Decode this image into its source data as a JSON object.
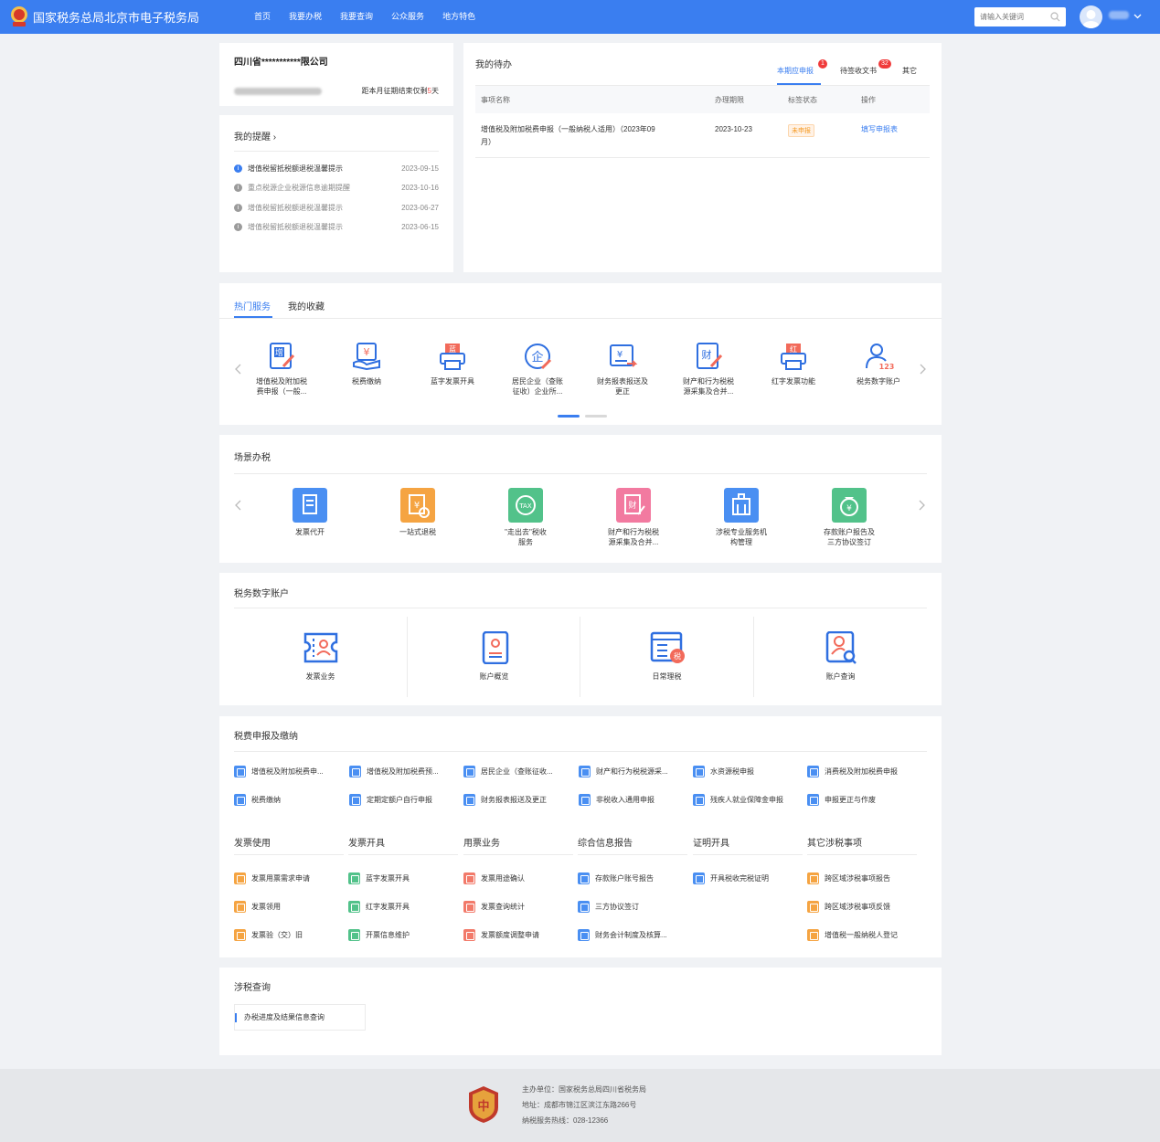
{
  "header": {
    "title": "国家税务总局北京市电子税务局",
    "nav": [
      "首页",
      "我要办税",
      "我要查询",
      "公众服务",
      "地方特色"
    ],
    "search_placeholder": "请输入关键词"
  },
  "company": {
    "name": "四川省***********限公司",
    "deadline_prefix": "距本月征期结束仅剩",
    "deadline_days": "5",
    "deadline_suffix": "天"
  },
  "reminders": {
    "title": "我的提醒",
    "items": [
      {
        "text": "增值税留抵税额退税温馨提示",
        "date": "2023-09-15"
      },
      {
        "text": "重点税源企业税源信息逾期提醒",
        "date": "2023-10-16"
      },
      {
        "text": "增值税留抵税额退税温馨提示",
        "date": "2023-06-27"
      },
      {
        "text": "增值税留抵税额退税温馨提示",
        "date": "2023-06-15"
      }
    ]
  },
  "todo": {
    "title": "我的待办",
    "tabs": [
      {
        "label": "本期应申报",
        "badge": "1"
      },
      {
        "label": "待签收文书",
        "badge": "32"
      },
      {
        "label": "其它",
        "badge": ""
      }
    ],
    "columns": [
      "事项名称",
      "办理期限",
      "标签状态",
      "操作"
    ],
    "rows": [
      {
        "name_line1": "增值税及附加税费申报（一般纳税人适用）（2023年09",
        "name_line2": "月）",
        "deadline": "2023-10-23",
        "status": "未申报",
        "action": "填写申报表"
      }
    ]
  },
  "hot": {
    "tabs": [
      "热门服务",
      "我的收藏"
    ],
    "items": [
      {
        "label1": "增值税及附加税",
        "label2": "费申报（一般...",
        "glyph": "增"
      },
      {
        "label1": "税费缴纳",
        "label2": "",
        "glyph": "¥"
      },
      {
        "label1": "蓝字发票开具",
        "label2": "",
        "glyph": "蓝"
      },
      {
        "label1": "居民企业（查账",
        "label2": "征收）企业所...",
        "glyph": "企"
      },
      {
        "label1": "财务报表报送及",
        "label2": "更正",
        "glyph": "¥"
      },
      {
        "label1": "财产和行为税税",
        "label2": "源采集及合并...",
        "glyph": "财"
      },
      {
        "label1": "红字发票功能",
        "label2": "",
        "glyph": "红"
      },
      {
        "label1": "税务数字账户",
        "label2": "",
        "glyph": "123"
      }
    ]
  },
  "scenes": {
    "title": "场景办税",
    "items": [
      {
        "label1": "发票代开",
        "label2": "",
        "color": "#4a8ff2"
      },
      {
        "label1": "一站式退税",
        "label2": "",
        "color": "#f5a442"
      },
      {
        "label1": "\"走出去\"税收",
        "label2": "服务",
        "color": "#52c28a"
      },
      {
        "label1": "财产和行为税税",
        "label2": "源采集及合并...",
        "color": "#f27aa0"
      },
      {
        "label1": "涉税专业服务机",
        "label2": "构管理",
        "color": "#4a8ff2"
      },
      {
        "label1": "存款账户报告及",
        "label2": "三方协议签订",
        "color": "#52c28a"
      }
    ]
  },
  "digital": {
    "title": "税务数字账户",
    "items": [
      "发票业务",
      "账户概览",
      "日常理税",
      "账户查询"
    ]
  },
  "filing": {
    "title": "税费申报及缴纳",
    "row1": [
      "增值税及附加税费申...",
      "增值税及附加税费预...",
      "居民企业（查账征收...",
      "财产和行为税税源采...",
      "水资源税申报",
      "消费税及附加税费申报"
    ],
    "row2": [
      "税费缴纳",
      "定期定额户自行申报",
      "财务报表报送及更正",
      "非税收入通用申报",
      "残疾人就业保障金申报",
      "申报更正与作废"
    ],
    "sections": [
      {
        "title": "发票使用",
        "items": [
          "发票用票需求申请",
          "发票领用",
          "发票验（交）旧"
        ]
      },
      {
        "title": "发票开具",
        "items": [
          "蓝字发票开具",
          "红字发票开具",
          "开票信息维护"
        ]
      },
      {
        "title": "用票业务",
        "items": [
          "发票用途确认",
          "发票查询统计",
          "发票额度调整申请"
        ]
      },
      {
        "title": "综合信息报告",
        "items": [
          "存款账户账号报告",
          "三方协议签订",
          "财务会计制度及核算..."
        ]
      },
      {
        "title": "证明开具",
        "items": [
          "开具税收完税证明"
        ]
      },
      {
        "title": "其它涉税事项",
        "items": [
          "跨区域涉税事项报告",
          "跨区域涉税事项反馈",
          "增值税一般纳税人登记"
        ]
      }
    ]
  },
  "query": {
    "title": "涉税查询",
    "item": "办税进度及结果信息查询"
  },
  "footer": {
    "sponsor": "主办单位：国家税务总局四川省税务局",
    "address": "地址：成都市锦江区滨江东路266号",
    "hotline": "纳税服务热线：028-12366"
  },
  "colors": {
    "primary": "#3a7ef0",
    "danger": "#f03a3a",
    "warning": "#f59a23"
  }
}
